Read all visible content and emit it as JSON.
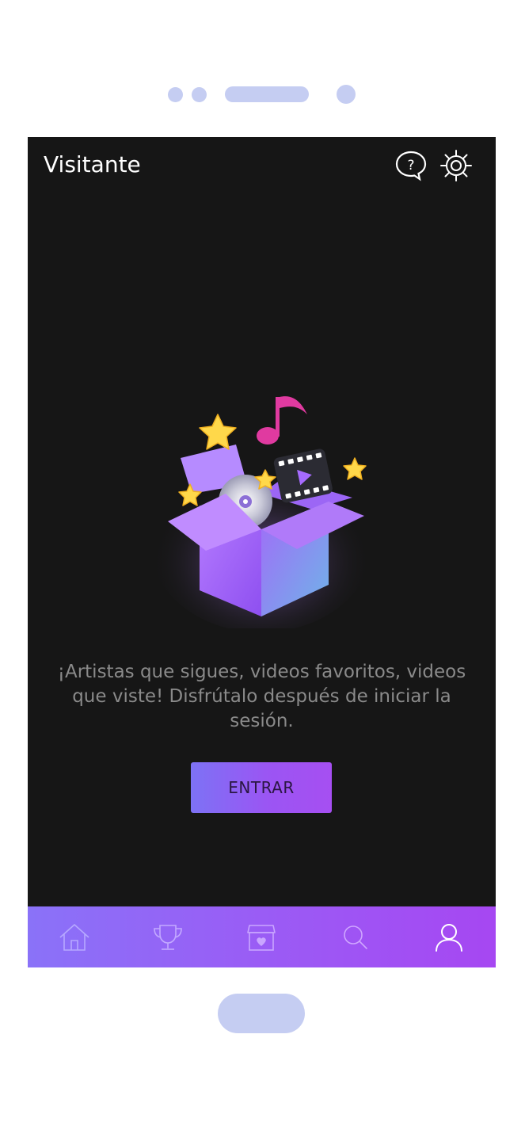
{
  "header": {
    "title": "Visitante",
    "help_icon": "help-bubble-icon",
    "settings_icon": "gear-icon"
  },
  "main": {
    "message": "¡Artistas que sigues, videos favoritos, videos que viste! Disfrútalo después de iniciar la sesión.",
    "enter_label": "ENTRAR"
  },
  "bottom_nav": {
    "items": [
      {
        "name": "home",
        "icon": "home-icon",
        "active": false
      },
      {
        "name": "trophy",
        "icon": "trophy-icon",
        "active": false
      },
      {
        "name": "box",
        "icon": "box-heart-icon",
        "active": false
      },
      {
        "name": "search",
        "icon": "search-icon",
        "active": false
      },
      {
        "name": "profile",
        "icon": "user-icon",
        "active": true
      }
    ]
  },
  "colors": {
    "background": "#161616",
    "accent_start": "#7d72f5",
    "accent_end": "#a64ff2",
    "text_muted": "#8a8a8a",
    "device_chrome": "#c5cdf2"
  }
}
